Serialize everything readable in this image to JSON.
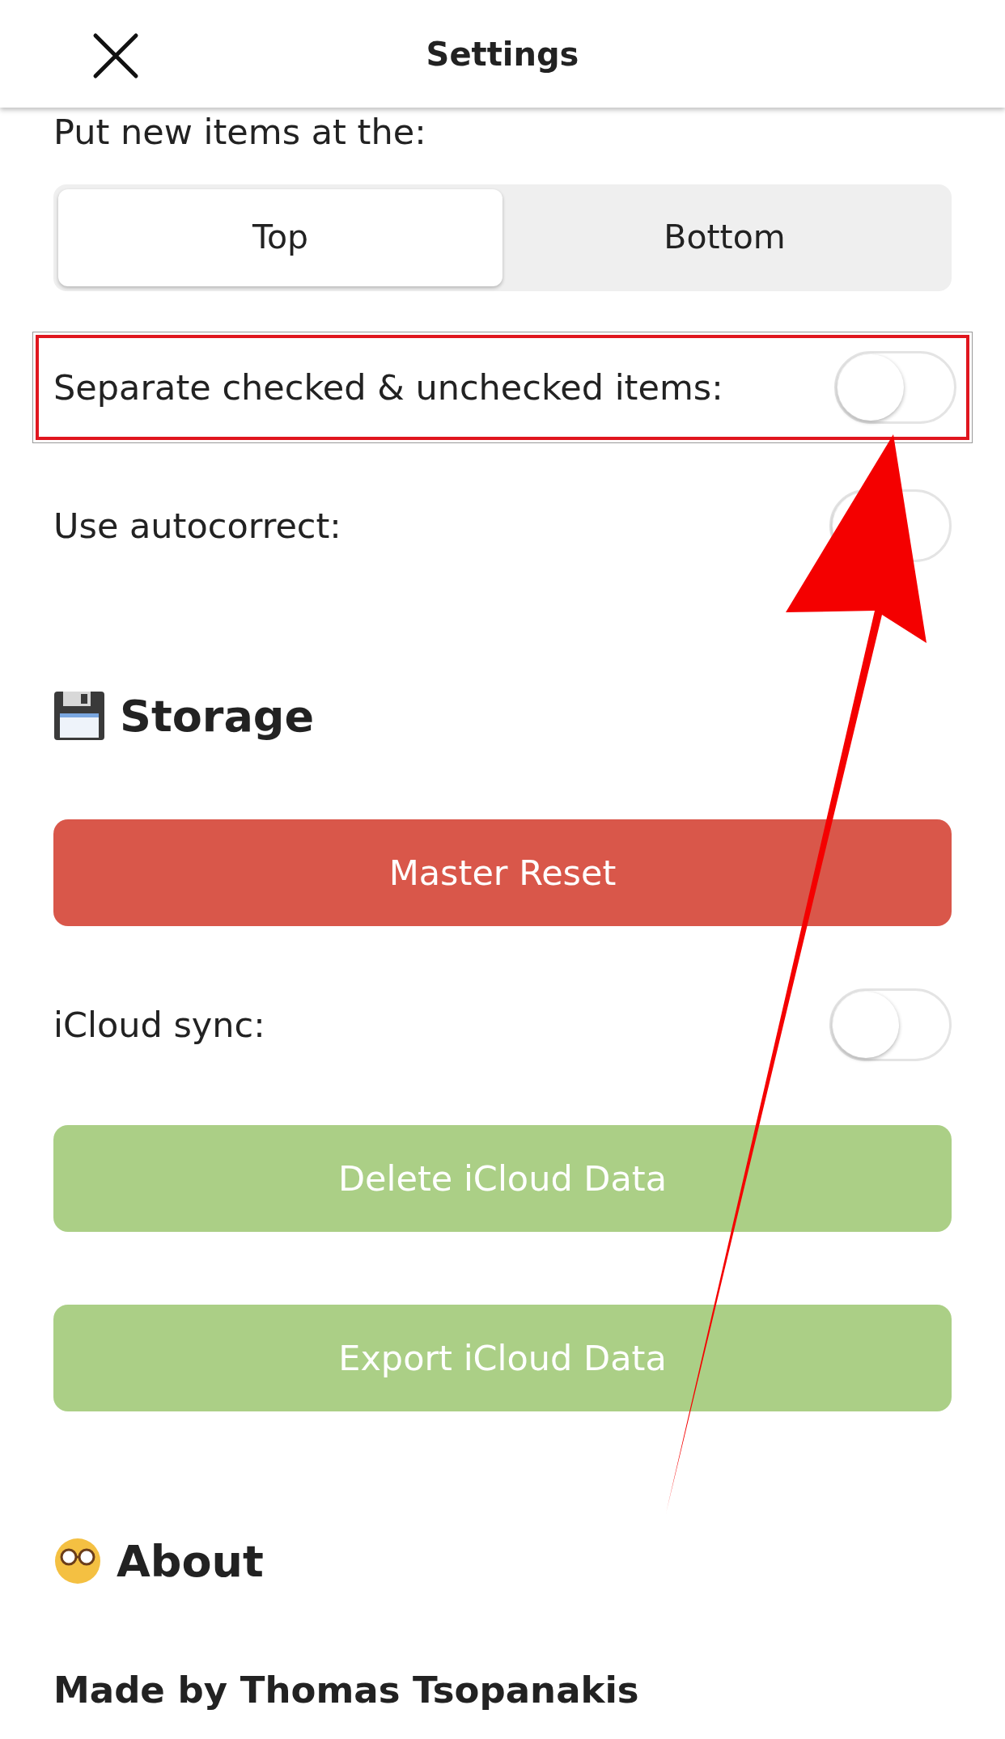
{
  "header": {
    "title": "Settings"
  },
  "position_setting": {
    "label": "Put new items at the:",
    "options": [
      {
        "label": "Top",
        "selected": true
      },
      {
        "label": "Bottom",
        "selected": false
      }
    ]
  },
  "toggles": [
    {
      "label": "Separate checked & unchecked items:",
      "on": false,
      "highlighted": true
    },
    {
      "label": "Use autocorrect:",
      "on": false,
      "highlighted": false
    }
  ],
  "storage": {
    "heading": "Storage",
    "buttons": [
      {
        "label": "Master Reset",
        "color": "#d9574a"
      }
    ],
    "toggles": [
      {
        "label": "iCloud sync:",
        "on": false
      }
    ],
    "buttons_after": [
      {
        "label": "Delete iCloud Data",
        "color": "#abcf86"
      },
      {
        "label": "Export iCloud Data",
        "color": "#abcf86"
      }
    ]
  },
  "about": {
    "heading": "About",
    "credit": "Made by Thomas Tsopanakis"
  },
  "annotation_arrow": true
}
